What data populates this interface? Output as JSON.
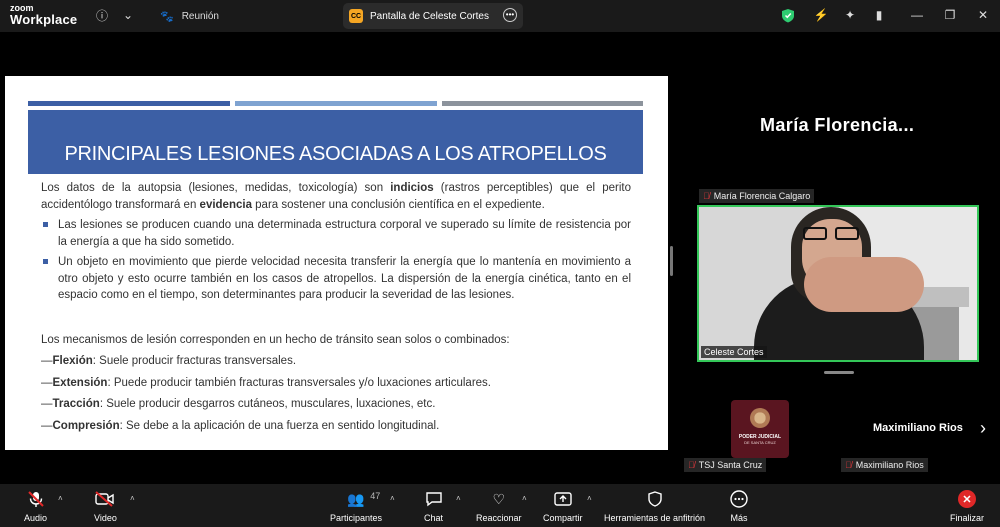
{
  "app": {
    "brand_line1": "zoom",
    "brand_line2": "Workplace"
  },
  "tabs": [
    {
      "label": "Reunión",
      "icon": "paw-icon"
    },
    {
      "label": "Pantalla de Celeste Cortes",
      "badge": "CC",
      "icon": "share-screen-icon"
    }
  ],
  "slide": {
    "title": "PRINCIPALES LESIONES ASOCIADAS A LOS ATROPELLOS",
    "intro_a": "Los datos de la autopsia (lesiones, medidas, toxicología) son ",
    "intro_b": "indicios",
    "intro_c": " (rastros perceptibles) que el perito accidentólogo transformará en ",
    "intro_d": "evidencia",
    "intro_e": " para sostener una conclusión científica en el expediente.",
    "bullets": [
      "Las lesiones se producen cuando una determinada estructura corporal ve superado su límite de resistencia por la energía a que ha sido sometido.",
      "Un objeto en movimiento que pierde velocidad necesita transferir la energía que lo mantenía en movimiento a otro objeto y esto ocurre también en los casos de atropellos. La dispersión de la energía cinética, tanto en el espacio como en el tiempo, son determinantes para producir la severidad de las lesiones."
    ],
    "mechanisms_intro": "Los mecanismos de lesión corresponden en un hecho de tránsito sean solos o combinados:",
    "mechanisms": [
      {
        "dash": "—",
        "term": "Flexión",
        "desc": ": Suele producir fracturas transversales."
      },
      {
        "dash": "—",
        "term": "Extensión",
        "desc": ": Puede producir también fracturas transversales y/o luxaciones articulares."
      },
      {
        "dash": "—",
        "term": "Tracción",
        "desc": ": Suele producir desgarros cutáneos, musculares, luxaciones, etc."
      },
      {
        "dash": "—",
        "term": "Compresión",
        "desc": ": Se debe a la aplicación de una fuerza en sentido longitudinal."
      }
    ],
    "bar_colors": [
      "#3c5fa5",
      "#7fa3d1",
      "#8c939c"
    ]
  },
  "participants_panel": {
    "speaker_name": "María  Florencia...",
    "speaker_tag": "María Florencia Calgaro",
    "video_label": "Celeste Cortes",
    "tsj_avatar_line1": "PODER JUDICIAL",
    "tsj_avatar_line2": "DE SANTA CRUZ",
    "tsj_tag": "TSJ Santa Cruz",
    "max_name": "Maximiliano Rios",
    "max_tag": "Maximiliano Rios"
  },
  "toolbar": {
    "audio": "Audio",
    "video": "Video",
    "participants": "Participantes",
    "participants_count": "47",
    "chat": "Chat",
    "react": "Reaccionar",
    "share": "Compartir",
    "host_tools": "Herramientas de anfitrión",
    "more": "Más",
    "end": "Finalizar"
  },
  "colors": {
    "accent_green": "#34c759",
    "danger": "#e02828",
    "slide_header": "#3c5fa5"
  }
}
